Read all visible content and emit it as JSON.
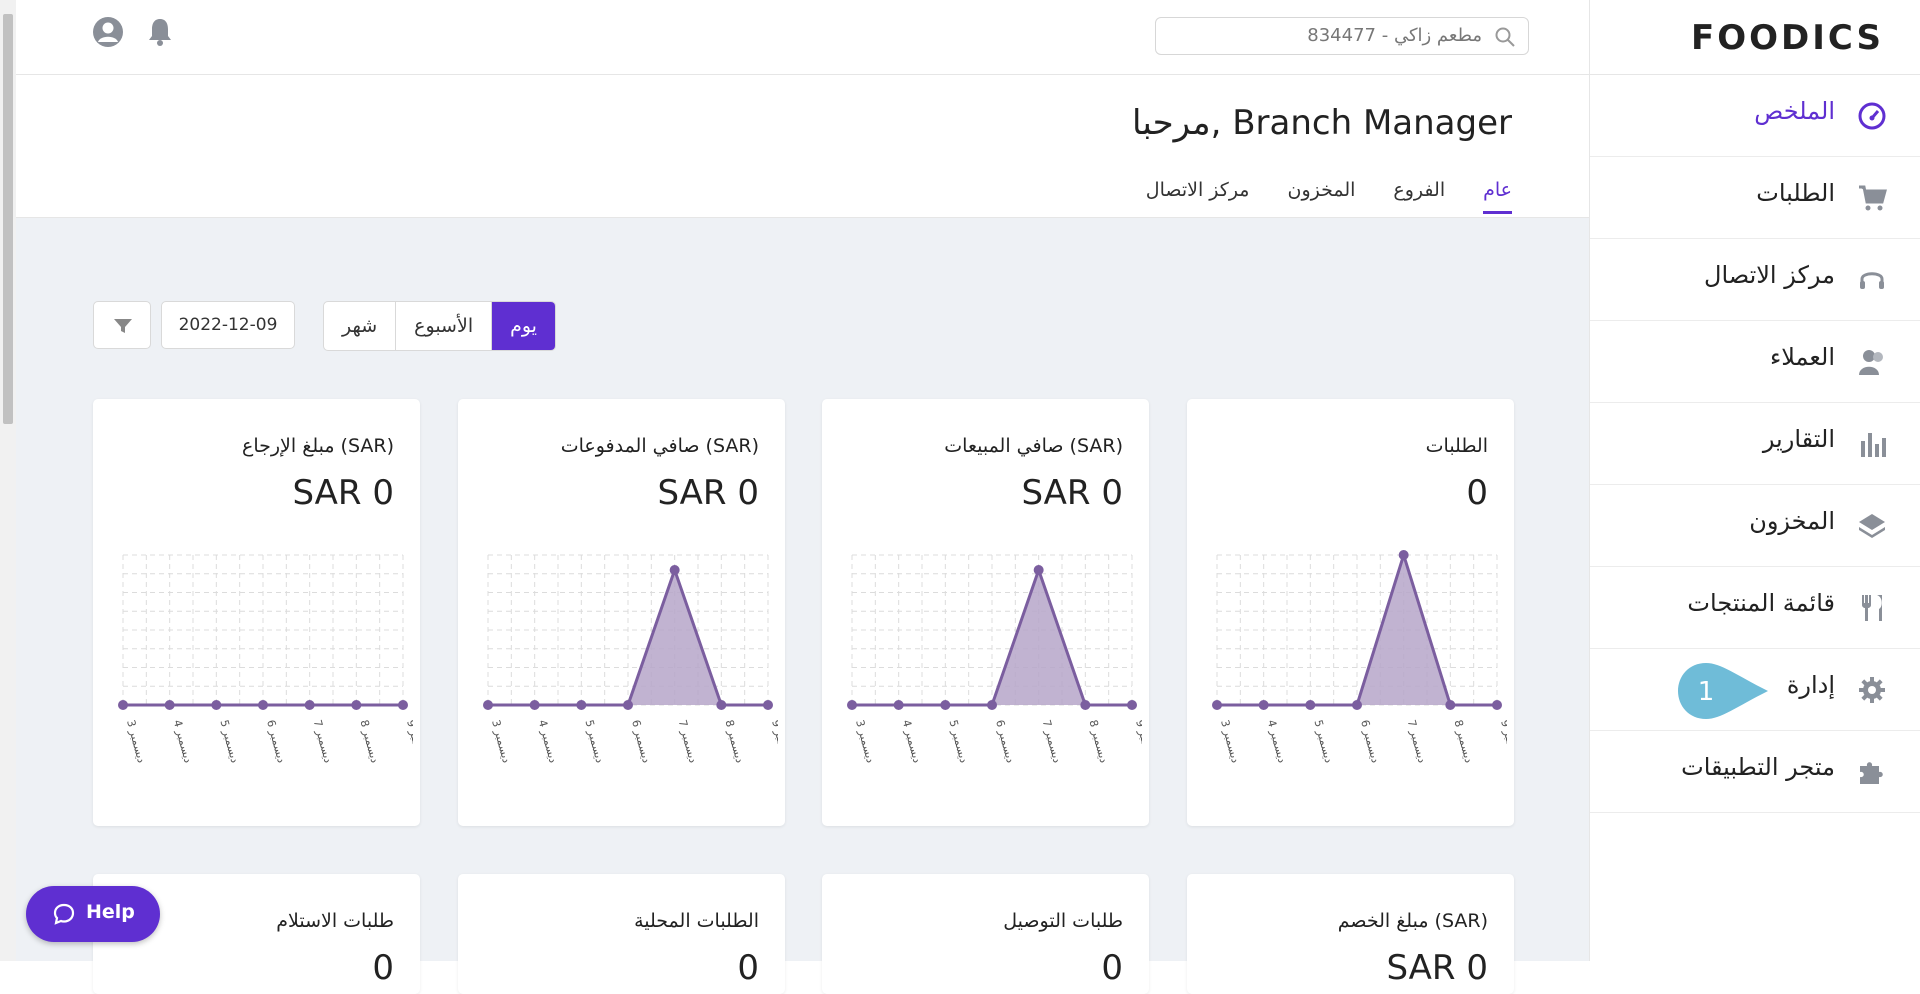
{
  "brand": {
    "logo_text": "FOODICS",
    "accent_color": "#5f2fd1"
  },
  "header": {
    "search": {
      "value": "مطعم زاكي - 834477",
      "icon": "search-icon"
    },
    "icons": [
      "user-account-icon",
      "bell-icon"
    ]
  },
  "sidebar": {
    "items": [
      {
        "label": "الملخص",
        "icon": "dashboard-gauge-icon",
        "active": true
      },
      {
        "label": "الطلبات",
        "icon": "cart-icon"
      },
      {
        "label": "مركز الاتصال",
        "icon": "headset-icon"
      },
      {
        "label": "العملاء",
        "icon": "customers-icon"
      },
      {
        "label": "التقارير",
        "icon": "bar-chart-icon"
      },
      {
        "label": "المخزون",
        "icon": "layers-icon"
      },
      {
        "label": "قائمة المنتجات",
        "icon": "fork-knife-icon"
      },
      {
        "label": "إدارة",
        "icon": "gear-icon"
      },
      {
        "label": "متجر التطبيقات",
        "icon": "puzzle-icon"
      }
    ],
    "step_badge": "1"
  },
  "welcome": {
    "title": "مرحبا, Branch Manager",
    "tabs": [
      {
        "label": "عام",
        "active": true
      },
      {
        "label": "الفروع"
      },
      {
        "label": "المخزون"
      },
      {
        "label": "مركز الاتصال"
      }
    ]
  },
  "filters": {
    "periods": [
      "يوم",
      "الأسبوع",
      "شهر"
    ],
    "selected_period": "يوم",
    "date": "2022-12-09",
    "filter_icon": "filter-funnel-icon"
  },
  "cards": [
    {
      "title": "الطلبات",
      "value": "0"
    },
    {
      "title": "صافي المبيعات (SAR)",
      "value": "SAR 0"
    },
    {
      "title": "صافي المدفوعات (SAR)",
      "value": "SAR 0"
    },
    {
      "title": "مبلغ الإرجاع (SAR)",
      "value": "SAR 0"
    }
  ],
  "cards_row2": [
    {
      "title": "مبلغ الخصم (SAR)",
      "value": "SAR 0"
    },
    {
      "title": "طلبات التوصيل",
      "value": "0"
    },
    {
      "title": "الطلبات المحلية",
      "value": "0"
    },
    {
      "title": "طلبات الاستلام",
      "value": "0"
    }
  ],
  "chart_data": [
    {
      "type": "area",
      "x": [
        "3 ديسمبر",
        "4 ديسمبر",
        "5 ديسمبر",
        "6 ديسمبر",
        "7 ديسمبر",
        "8 ديسمبر",
        "9 ديسمبر"
      ],
      "values": [
        0,
        0,
        0,
        0,
        1,
        0,
        0
      ]
    },
    {
      "type": "area",
      "x": [
        "3 ديسمبر",
        "4 ديسمبر",
        "5 ديسمبر",
        "6 ديسمبر",
        "7 ديسمبر",
        "8 ديسمبر",
        "9 ديسمبر"
      ],
      "values": [
        0,
        0,
        0,
        0,
        0.9,
        0,
        0
      ]
    },
    {
      "type": "area",
      "x": [
        "3 ديسمبر",
        "4 ديسمبر",
        "5 ديسمبر",
        "6 ديسمبر",
        "7 ديسمبر",
        "8 ديسمبر",
        "9 ديسمبر"
      ],
      "values": [
        0,
        0,
        0,
        0,
        0.9,
        0,
        0
      ]
    },
    {
      "type": "area",
      "x": [
        "3 ديسمبر",
        "4 ديسمبر",
        "5 ديسمبر",
        "6 ديسمبر",
        "7 ديسمبر",
        "8 ديسمبر",
        "9 ديسمبر"
      ],
      "values": [
        0,
        0,
        0,
        0,
        0,
        0,
        0
      ]
    }
  ],
  "help": {
    "label": "Help",
    "icon": "chat-bubble-icon"
  }
}
